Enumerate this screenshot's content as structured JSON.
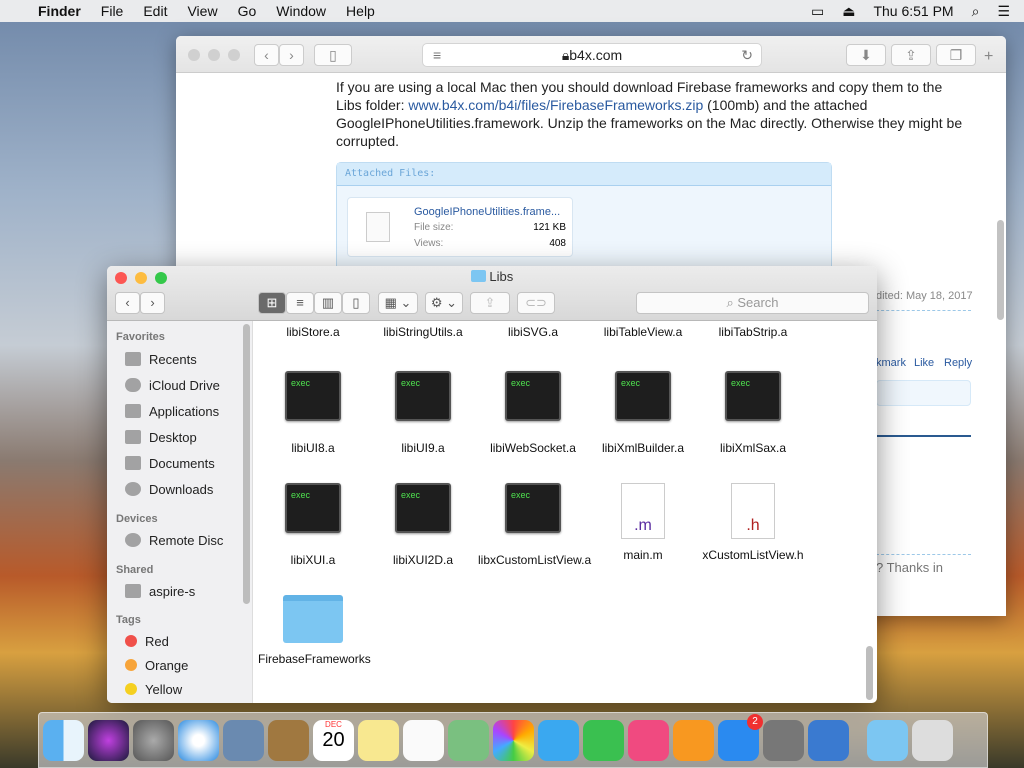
{
  "menubar": {
    "app": "Finder",
    "items": [
      "File",
      "Edit",
      "View",
      "Go",
      "Window",
      "Help"
    ],
    "clock": "Thu 6:51 PM"
  },
  "safari": {
    "url": "b4x.com",
    "paragraph_pre": "If you are using a local Mac then you should download Firebase frameworks and copy them to the Libs folder: ",
    "link": "www.b4x.com/b4i/files/FirebaseFrameworks.zip",
    "paragraph_post": " (100mb) and the attached GoogleIPhoneUtilities.framework. Unzip the frameworks on the Mac directly. Otherwise they might be corrupted.",
    "attached_header": "Attached Files:",
    "file": {
      "name": "GoogleIPhoneUtilities.frame...",
      "size_label": "File size:",
      "size": "121 KB",
      "views_label": "Views:",
      "views": "408"
    },
    "edited": "dited: May 18, 2017",
    "actions": [
      "kmark",
      "Like",
      "Reply"
    ],
    "snippet": "? Thanks in"
  },
  "finder": {
    "title": "Libs",
    "search_placeholder": "Search",
    "sidebar": {
      "favorites_label": "Favorites",
      "favorites": [
        "Recents",
        "iCloud Drive",
        "Applications",
        "Desktop",
        "Documents",
        "Downloads"
      ],
      "devices_label": "Devices",
      "devices": [
        "Remote Disc"
      ],
      "shared_label": "Shared",
      "shared": [
        "aspire-s"
      ],
      "tags_label": "Tags",
      "tags": [
        {
          "name": "Red",
          "color": "#f0504a"
        },
        {
          "name": "Orange",
          "color": "#f7a43a"
        },
        {
          "name": "Yellow",
          "color": "#f5d020"
        }
      ]
    },
    "files": [
      {
        "name": "libiStore.a",
        "kind": "partial"
      },
      {
        "name": "libiStringUtils.a",
        "kind": "partial"
      },
      {
        "name": "libiSVG.a",
        "kind": "partial"
      },
      {
        "name": "libiTableView.a",
        "kind": "partial"
      },
      {
        "name": "libiTabStrip.a",
        "kind": "partial"
      },
      {
        "name": "libiUI8.a",
        "kind": "exec"
      },
      {
        "name": "libiUI9.a",
        "kind": "exec"
      },
      {
        "name": "libiWebSocket.a",
        "kind": "exec"
      },
      {
        "name": "libiXmlBuilder.a",
        "kind": "exec"
      },
      {
        "name": "libiXmlSax.a",
        "kind": "exec"
      },
      {
        "name": "libiXUI.a",
        "kind": "exec"
      },
      {
        "name": "libiXUI2D.a",
        "kind": "exec"
      },
      {
        "name": "libxCustomListView.a",
        "kind": "exec"
      },
      {
        "name": "main.m",
        "kind": "m"
      },
      {
        "name": "xCustomListView.h",
        "kind": "h"
      },
      {
        "name": "FirebaseFrameworks",
        "kind": "folder"
      }
    ],
    "exec_label": "exec"
  },
  "dock": {
    "calendar_month": "DEC",
    "calendar_day": "20",
    "appstore_badge": "2"
  }
}
